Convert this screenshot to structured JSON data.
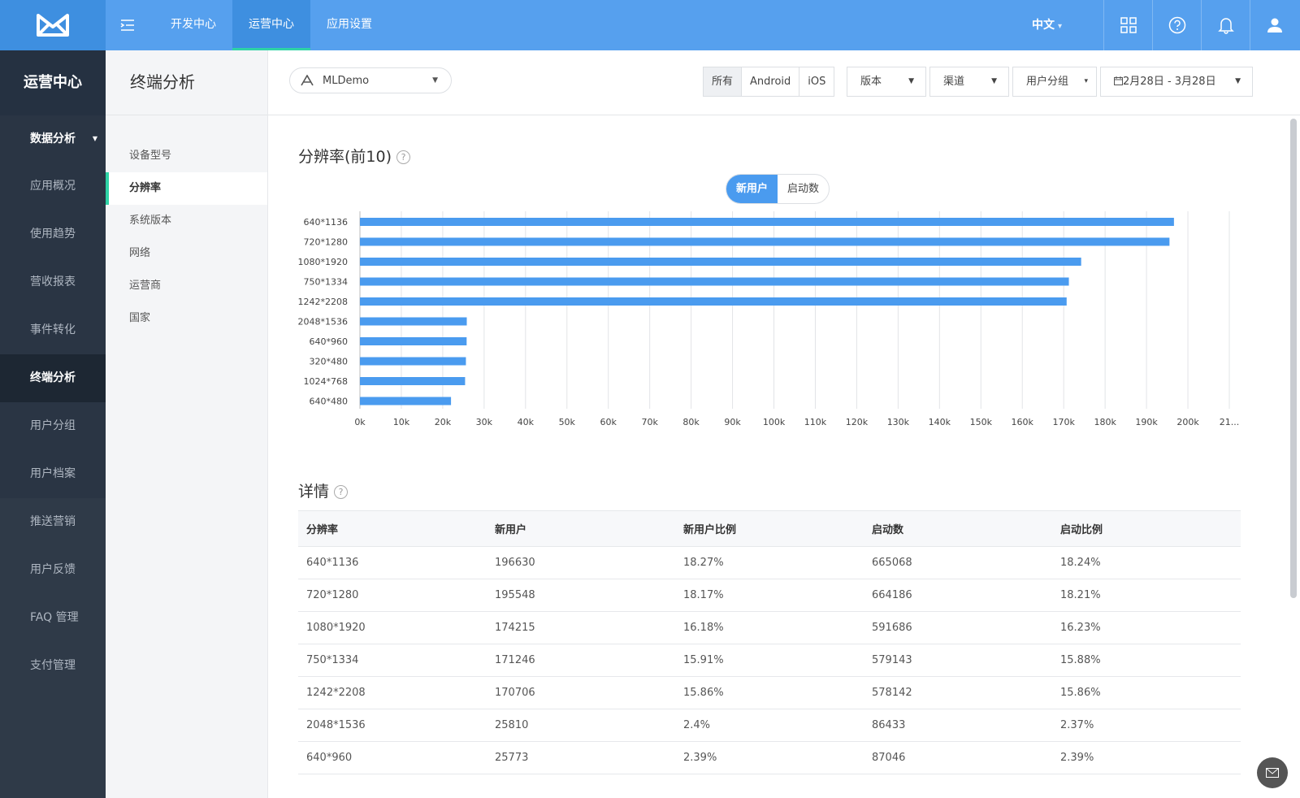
{
  "top_nav": {
    "items": [
      {
        "label": "开发中心",
        "active": false
      },
      {
        "label": "运营中心",
        "active": true
      },
      {
        "label": "应用设置",
        "active": false
      }
    ],
    "language": "中文"
  },
  "sidebar": {
    "header": "运营中心",
    "group_label": "数据分析",
    "items": [
      "应用概况",
      "使用趋势",
      "营收报表",
      "事件转化",
      "终端分析",
      "用户分组",
      "用户档案"
    ],
    "active_item": "终端分析",
    "other_items": [
      "推送营销",
      "用户反馈",
      "FAQ 管理",
      "支付管理"
    ]
  },
  "subnav": {
    "title": "终端分析",
    "items": [
      "设备型号",
      "分辨率",
      "系统版本",
      "网络",
      "运营商",
      "国家"
    ],
    "active_item": "分辨率"
  },
  "filters": {
    "app_name": "MLDemo",
    "platforms": [
      "所有",
      "Android",
      "iOS"
    ],
    "active_platform": "所有",
    "version_label": "版本",
    "channel_label": "渠道",
    "group_label": "用户分组",
    "date_range": "2月28日 - 3月28日"
  },
  "chart_section": {
    "title": "分辨率(前10)",
    "help": "?",
    "toggle": [
      "新用户",
      "启动数"
    ],
    "active_toggle": "新用户"
  },
  "chart_data": {
    "type": "bar",
    "orientation": "horizontal",
    "categories": [
      "640*1136",
      "720*1280",
      "1080*1920",
      "750*1334",
      "1242*2208",
      "2048*1536",
      "640*960",
      "320*480",
      "1024*768",
      "640*480"
    ],
    "values": [
      196630,
      195548,
      174215,
      171246,
      170706,
      25810,
      25773,
      25600,
      25400,
      22000
    ],
    "x_ticks": [
      "0k",
      "10k",
      "20k",
      "30k",
      "40k",
      "50k",
      "60k",
      "70k",
      "80k",
      "90k",
      "100k",
      "110k",
      "120k",
      "130k",
      "140k",
      "150k",
      "160k",
      "170k",
      "180k",
      "190k",
      "200k",
      "21..."
    ],
    "xlim": [
      0,
      210000
    ],
    "grid": true,
    "color": "#4a9bef"
  },
  "details": {
    "title": "详情",
    "help": "?",
    "columns": [
      "分辨率",
      "新用户",
      "新用户比例",
      "启动数",
      "启动比例"
    ],
    "rows": [
      [
        "640*1136",
        "196630",
        "18.27%",
        "665068",
        "18.24%"
      ],
      [
        "720*1280",
        "195548",
        "18.17%",
        "664186",
        "18.21%"
      ],
      [
        "1080*1920",
        "174215",
        "16.18%",
        "591686",
        "16.23%"
      ],
      [
        "750*1334",
        "171246",
        "15.91%",
        "579143",
        "15.88%"
      ],
      [
        "1242*2208",
        "170706",
        "15.86%",
        "578142",
        "15.86%"
      ],
      [
        "2048*1536",
        "25810",
        "2.4%",
        "86433",
        "2.37%"
      ],
      [
        "640*960",
        "25773",
        "2.39%",
        "87046",
        "2.39%"
      ]
    ]
  },
  "colors": {
    "topbar": "#56a0ee",
    "sidebar": "#2f3a48",
    "accent": "#2ed3a6",
    "bar": "#4a9bef"
  }
}
